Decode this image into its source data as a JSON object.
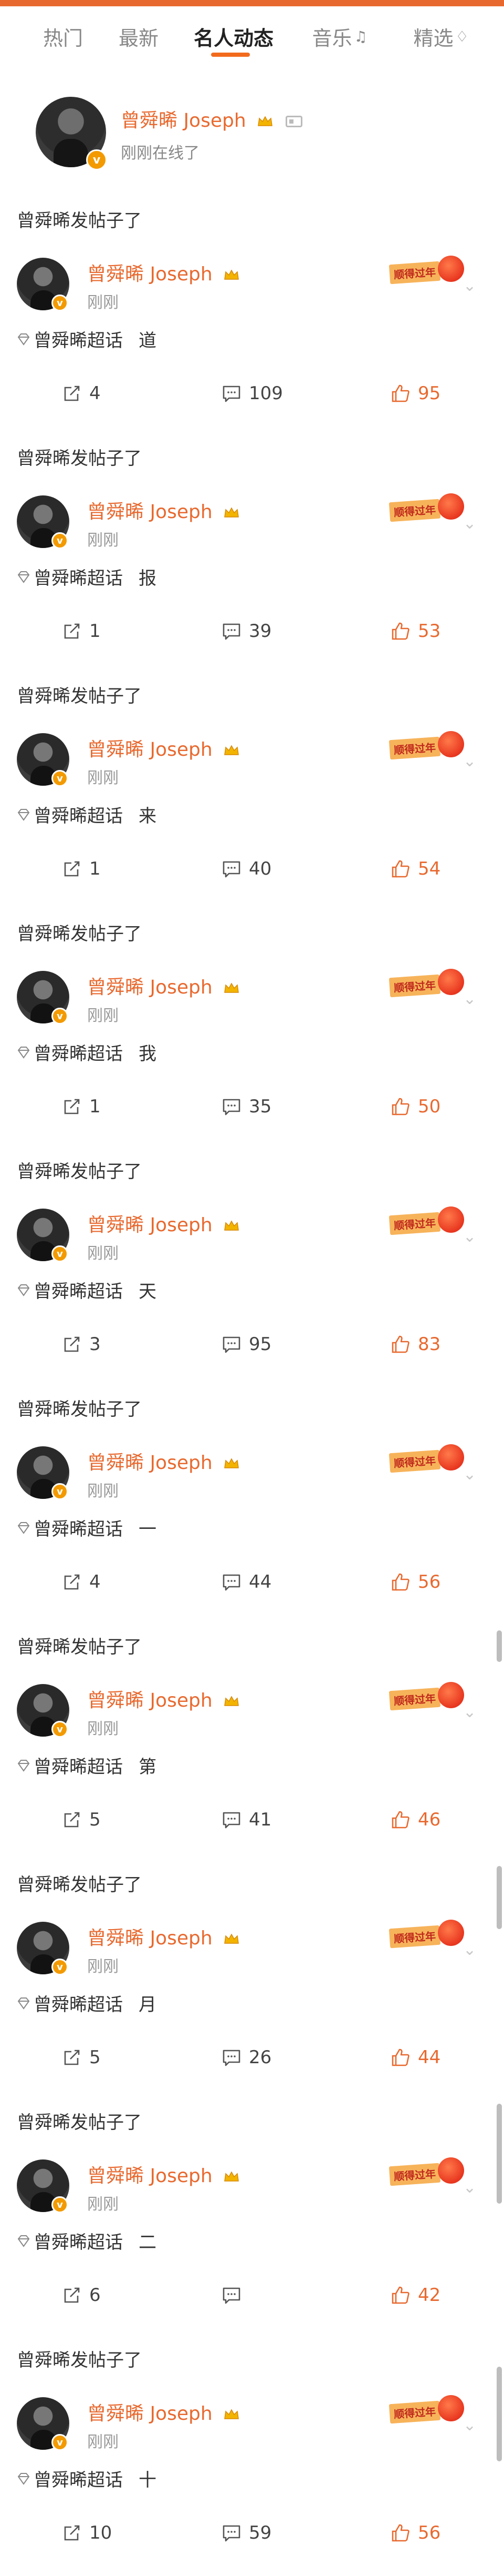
{
  "tabs": [
    {
      "label": "热门"
    },
    {
      "label": "最新"
    },
    {
      "label": "名人动态",
      "active": true
    },
    {
      "label": "音乐"
    },
    {
      "label": "精选"
    }
  ],
  "profile": {
    "name": "曾舜晞 Joseph",
    "status": "刚刚在线了",
    "verified_mark": "v"
  },
  "colors": {
    "accent": "#e8692f",
    "verified": "#f39a00",
    "muted": "#999999"
  },
  "posts": [
    {
      "header": "曾舜晞发帖子了",
      "name": "曾舜晞 Joseph",
      "time": "刚刚",
      "topic": "曾舜晞超话",
      "text": "道",
      "shares": "4",
      "comments": "109",
      "likes": "95",
      "stamp": "顺得过年"
    },
    {
      "header": "曾舜晞发帖子了",
      "name": "曾舜晞 Joseph",
      "time": "刚刚",
      "topic": "曾舜晞超话",
      "text": "报",
      "shares": "1",
      "comments": "39",
      "likes": "53",
      "stamp": "顺得过年"
    },
    {
      "header": "曾舜晞发帖子了",
      "name": "曾舜晞 Joseph",
      "time": "刚刚",
      "topic": "曾舜晞超话",
      "text": "来",
      "shares": "1",
      "comments": "40",
      "likes": "54",
      "stamp": "顺得过年"
    },
    {
      "header": "曾舜晞发帖子了",
      "name": "曾舜晞 Joseph",
      "time": "刚刚",
      "topic": "曾舜晞超话",
      "text": "我",
      "shares": "1",
      "comments": "35",
      "likes": "50",
      "stamp": "顺得过年"
    },
    {
      "header": "曾舜晞发帖子了",
      "name": "曾舜晞 Joseph",
      "time": "刚刚",
      "topic": "曾舜晞超话",
      "text": "天",
      "shares": "3",
      "comments": "95",
      "likes": "83",
      "stamp": "顺得过年"
    },
    {
      "header": "曾舜晞发帖子了",
      "name": "曾舜晞 Joseph",
      "time": "刚刚",
      "topic": "曾舜晞超话",
      "text": "一",
      "shares": "4",
      "comments": "44",
      "likes": "56",
      "stamp": "顺得过年"
    },
    {
      "header": "曾舜晞发帖子了",
      "name": "曾舜晞 Joseph",
      "time": "刚刚",
      "topic": "曾舜晞超话",
      "text": "第",
      "shares": "5",
      "comments": "41",
      "likes": "46",
      "stamp": "顺得过年"
    },
    {
      "header": "曾舜晞发帖子了",
      "name": "曾舜晞 Joseph",
      "time": "刚刚",
      "topic": "曾舜晞超话",
      "text": "月",
      "shares": "5",
      "comments": "26",
      "likes": "44",
      "stamp": "顺得过年"
    },
    {
      "header": "曾舜晞发帖子了",
      "name": "曾舜晞 Joseph",
      "time": "刚刚",
      "topic": "曾舜晞超话",
      "text": "二",
      "shares": "6",
      "comments": "",
      "likes": "42",
      "stamp": "顺得过年"
    },
    {
      "header": "曾舜晞发帖子了",
      "name": "曾舜晞 Joseph",
      "time": "刚刚",
      "topic": "曾舜晞超话",
      "text": "十",
      "shares": "10",
      "comments": "59",
      "likes": "56",
      "stamp": "顺得过年"
    }
  ]
}
